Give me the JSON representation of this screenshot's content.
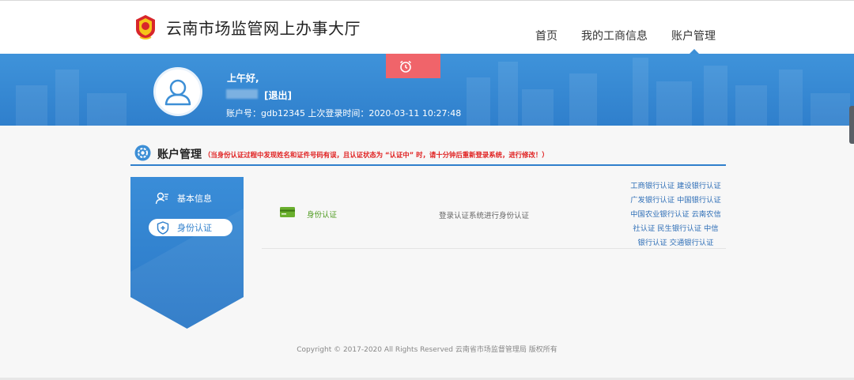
{
  "header": {
    "site_title": "云南市场监管网上办事大厅",
    "nav": [
      {
        "label": "首页"
      },
      {
        "label": "我的工商信息"
      },
      {
        "label": "账户管理",
        "active": true
      }
    ]
  },
  "banner": {
    "greeting": "上午好,",
    "logout_label": "[退出]",
    "account_line": "账户号：gdb12345 上次登录时间：2020-03-11 10:27:48",
    "alarm_icon": "alarm-clock-icon"
  },
  "section": {
    "title": "账户管理",
    "note": "（当身份认证过程中发现姓名和证件号码有误，且认证状态为 “认证中” 时，请十分钟后重新登录系统，进行修改！）"
  },
  "side_menu": {
    "items": [
      {
        "label": "基本信息",
        "icon": "user-info-icon",
        "active": false
      },
      {
        "label": "身份认证",
        "icon": "shield-icon",
        "active": true
      }
    ]
  },
  "content": {
    "auth_label": "身份认证",
    "auth_desc": "登录认证系统进行身份认证",
    "bank_lines": [
      "工商银行认证 建设银行认证",
      "广发银行认证 中国银行认证",
      "中国农业银行认证 云南农信",
      "社认证 民生银行认证 中信",
      "银行认证 交通银行认证"
    ]
  },
  "footer": {
    "copyright": "Copyright © 2017-2020 All Rights Reserved 云南省市场监督管理局 版权所有"
  },
  "colors": {
    "primary_blue": "#2f7fcc",
    "alert_red": "#e02020",
    "alarm_button": "#f0646a",
    "success_green": "#4d9a1e"
  }
}
